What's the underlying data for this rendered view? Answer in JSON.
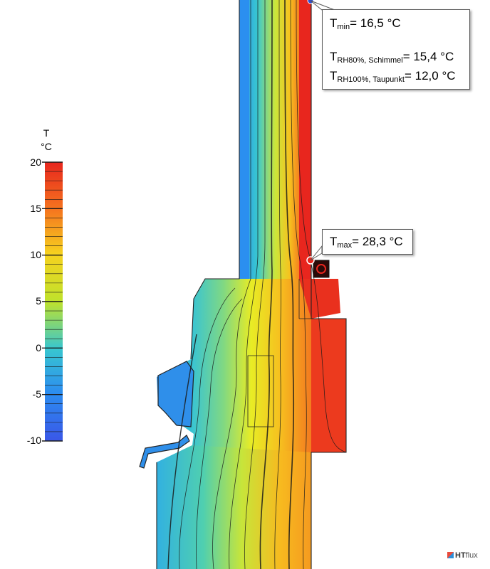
{
  "legend": {
    "title_symbol": "T",
    "title_unit": "°C",
    "ticks": [
      "20",
      "15",
      "10",
      "5",
      "0",
      "-5",
      "-10"
    ],
    "range": [
      -10,
      20
    ]
  },
  "callout_min": {
    "symbol": "T",
    "subscript": "min",
    "value": "= 16,5 °C"
  },
  "callout_rh80": {
    "symbol": "T",
    "subscript": "RH80%, Schimmel",
    "value": "= 15,4 °C"
  },
  "callout_rh100": {
    "symbol": "T",
    "subscript": "RH100%, Taupunkt",
    "value": "= 12,0 °C"
  },
  "callout_max": {
    "symbol": "T",
    "subscript": "max",
    "value": "= 28,3 °C"
  },
  "logo": {
    "brand": "HT",
    "suffix": "flux"
  },
  "colors": {
    "cold": "#3a57e8",
    "mid": "#f2ee1e",
    "warm": "#e8261e",
    "marker_min": "#2c4fd6",
    "marker_max": "#e8261e"
  }
}
